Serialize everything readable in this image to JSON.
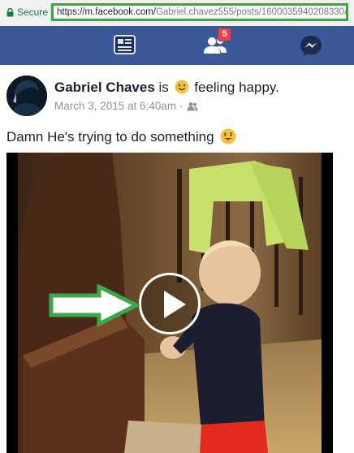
{
  "browser": {
    "secure_label": "Secure",
    "url_host": "https://m.facebook.com/",
    "url_path": "Gabriel.chavez555/posts/1600035940208330/",
    "secure_color": "#0b8043",
    "highlight_color": "#3aa847"
  },
  "nav": {
    "brand_color": "#3b5998",
    "items": [
      {
        "icon": "news-feed-icon"
      },
      {
        "icon": "friend-requests-icon",
        "badge": "5"
      },
      {
        "icon": "messenger-icon"
      }
    ]
  },
  "post": {
    "author": "Gabriel Chaves",
    "is_text": "is",
    "feeling": "feeling happy.",
    "timestamp": "March 3, 2015 at 6:40am",
    "separator": "·",
    "privacy_icon": "friends-icon",
    "text": "Damn He's trying to do something",
    "text_emoji": "tongue-out-emoji",
    "video": {
      "play_icon": "play-icon",
      "annotation": "green-arrow-pointing-to-play"
    }
  }
}
